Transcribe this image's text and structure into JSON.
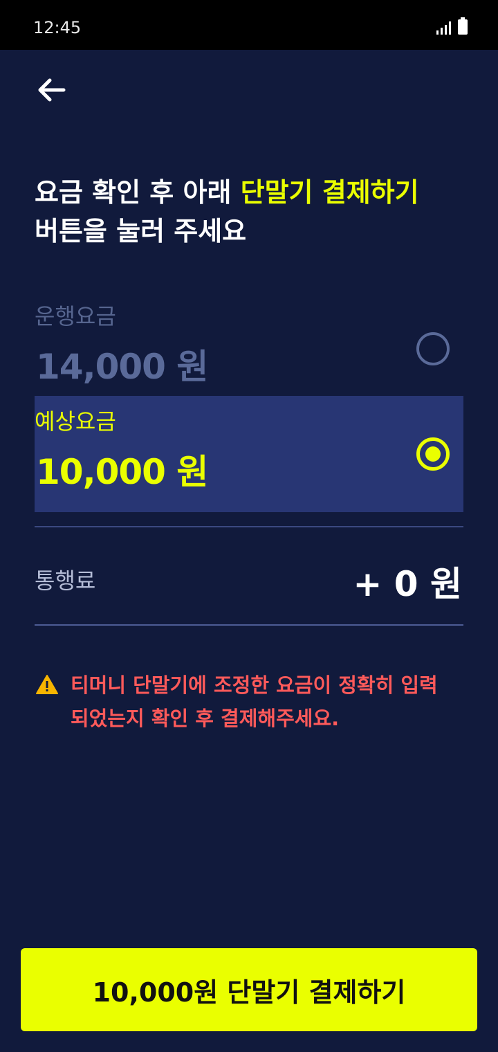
{
  "status_bar": {
    "time": "12:45"
  },
  "header": {
    "back_icon": "arrow-left-icon"
  },
  "headline": {
    "part1": "요금 확인 후 아래 ",
    "highlight": "단말기 결제하기",
    "part2": "버튼을 눌러 주세요"
  },
  "fare_options": [
    {
      "label": "운행요금",
      "amount": "14,000 원",
      "selected": false
    },
    {
      "label": "예상요금",
      "amount": "10,000 원",
      "selected": true
    }
  ],
  "toll": {
    "label": "통행료",
    "amount": "+ 0 원"
  },
  "warning": {
    "icon": "warning-icon",
    "text_line1": "티머니 단말기에 조정한 요금이 정확히 입력",
    "text_line2": "되었는지 확인 후 결제해주세요."
  },
  "pay_button": {
    "label": "10,000원 단말기 결제하기"
  },
  "colors": {
    "background": "#111a3c",
    "accent": "#eaff00",
    "selected_bg": "#283674",
    "warning": "#ff5a5a"
  }
}
